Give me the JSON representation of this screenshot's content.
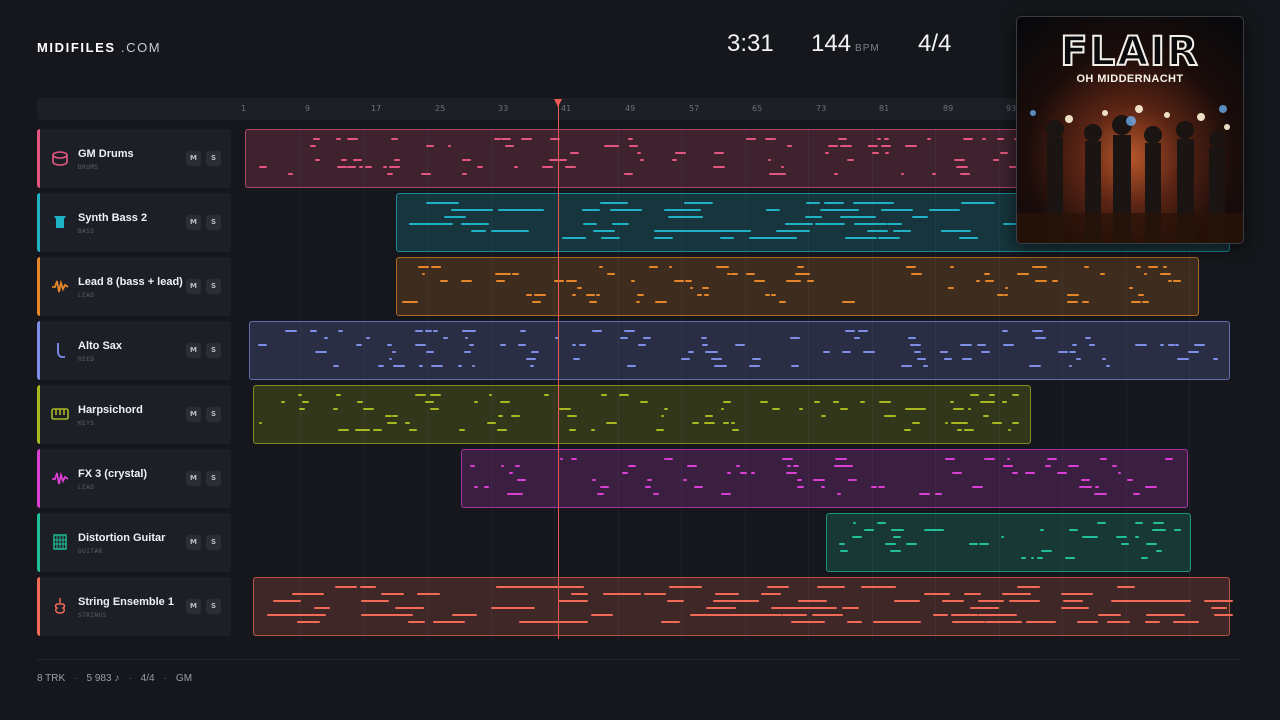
{
  "brand": {
    "name_bold": "MIDIFILES",
    "name_light": " .COM"
  },
  "header": {
    "duration": "3:31",
    "tempo": "144",
    "tempo_unit": "BPM",
    "time_signature": "4/4"
  },
  "ruler": {
    "ticks": [
      "1",
      "9",
      "17",
      "25",
      "33",
      "41",
      "49",
      "57",
      "65",
      "73",
      "81",
      "89",
      "93"
    ]
  },
  "playhead": {
    "bar": 41
  },
  "tracks": [
    {
      "name": "GM Drums",
      "category": "DRUMS",
      "color": "#e4557f",
      "icon": "drum-icon",
      "mute": "M",
      "solo": "S"
    },
    {
      "name": "Synth Bass 2",
      "category": "BASS",
      "color": "#1fb1c4",
      "icon": "bass-icon",
      "mute": "M",
      "solo": "S"
    },
    {
      "name": "Lead 8 (bass + lead)",
      "category": "LEAD",
      "color": "#e6862a",
      "icon": "waveform-icon",
      "mute": "M",
      "solo": "S"
    },
    {
      "name": "Alto Sax",
      "category": "REED",
      "color": "#7e8de6",
      "icon": "saxophone-icon",
      "mute": "M",
      "solo": "S"
    },
    {
      "name": "Harpsichord",
      "category": "KEYS",
      "color": "#a8b820",
      "icon": "keyboard-icon",
      "mute": "M",
      "solo": "S"
    },
    {
      "name": "FX 3 (crystal)",
      "category": "LEAD",
      "color": "#d93fd2",
      "icon": "waveform-icon",
      "mute": "M",
      "solo": "S"
    },
    {
      "name": "Distortion Guitar",
      "category": "GUITAR",
      "color": "#22c09a",
      "icon": "guitar-neck-icon",
      "mute": "M",
      "solo": "S"
    },
    {
      "name": "String Ensemble 1",
      "category": "STRINGS",
      "color": "#f06a55",
      "icon": "violin-icon",
      "mute": "M",
      "solo": "S"
    }
  ],
  "album": {
    "artist": "FLAIR",
    "title": "OH MIDDERNACHT"
  },
  "footer": {
    "tracks": "8 TRK",
    "notes": "5 983 ♪",
    "signature": "4/4",
    "standard": "GM"
  }
}
